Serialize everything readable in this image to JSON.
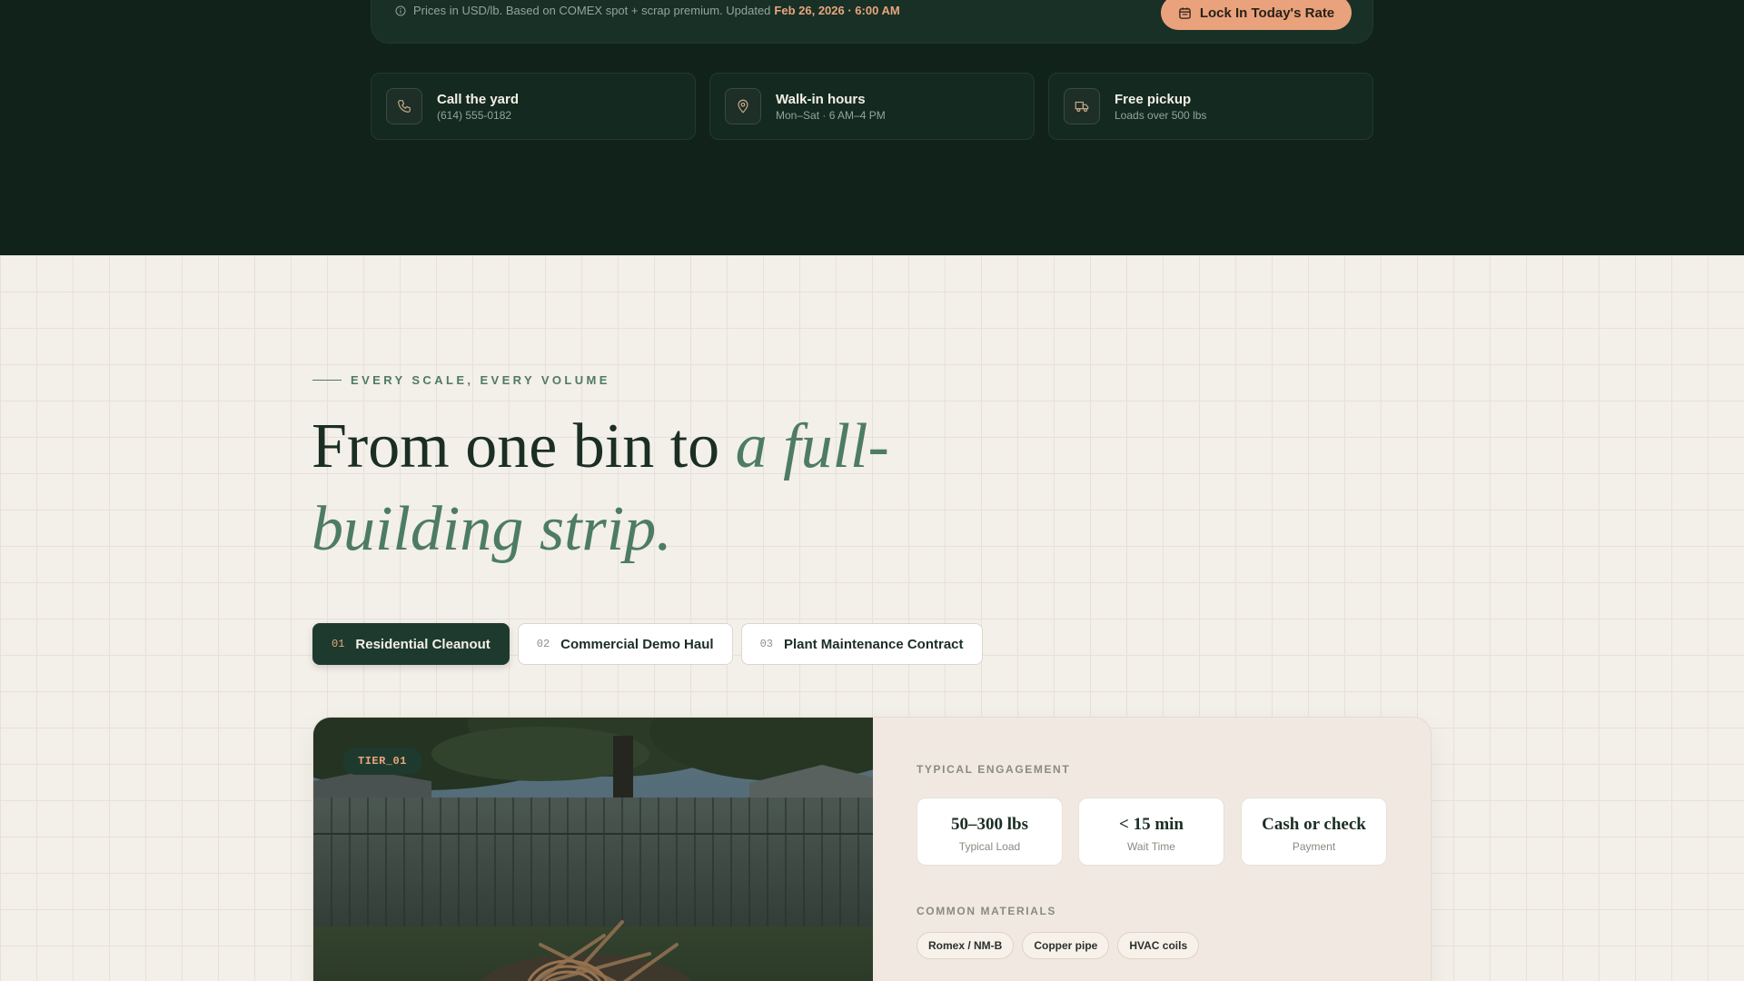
{
  "pricing": {
    "note": "Prices in USD/lb. Based on COMEX spot + scrap premium. Updated",
    "updated": "Feb 26, 2026 · 6:00 AM",
    "cta_label": "Lock In Today's Rate"
  },
  "info_cards": [
    {
      "icon": "phone-icon",
      "title": "Call the yard",
      "sub": "(614) 555-0182"
    },
    {
      "icon": "map-pin-icon",
      "title": "Walk-in hours",
      "sub": "Mon–Sat · 6 AM–4 PM"
    },
    {
      "icon": "truck-icon",
      "title": "Free pickup",
      "sub": "Loads over 500 lbs"
    }
  ],
  "section": {
    "eyebrow": "EVERY SCALE, EVERY VOLUME",
    "headline_plain": "From one bin to ",
    "headline_accent": "a full-building strip."
  },
  "tabs": [
    {
      "num": "01",
      "label": "Residential Cleanout",
      "active": true
    },
    {
      "num": "02",
      "label": "Commercial Demo Haul",
      "active": false
    },
    {
      "num": "03",
      "label": "Plant Maintenance Contract",
      "active": false
    }
  ],
  "tier": {
    "badge": "TIER_01",
    "engagement_label": "TYPICAL ENGAGEMENT",
    "stats": [
      {
        "value": "50–300 lbs",
        "label": "Typical Load"
      },
      {
        "value": "< 15 min",
        "label": "Wait Time"
      },
      {
        "value": "Cash or check",
        "label": "Payment"
      }
    ],
    "materials_label": "COMMON MATERIALS",
    "materials": [
      "Romex / NM-B",
      "Copper pipe",
      "HVAC coils"
    ]
  },
  "colors": {
    "dark_bg": "#10221a",
    "accent_orange": "#e9a27c",
    "accent_green": "#4d7c63",
    "light_bg": "#f3efe9"
  }
}
